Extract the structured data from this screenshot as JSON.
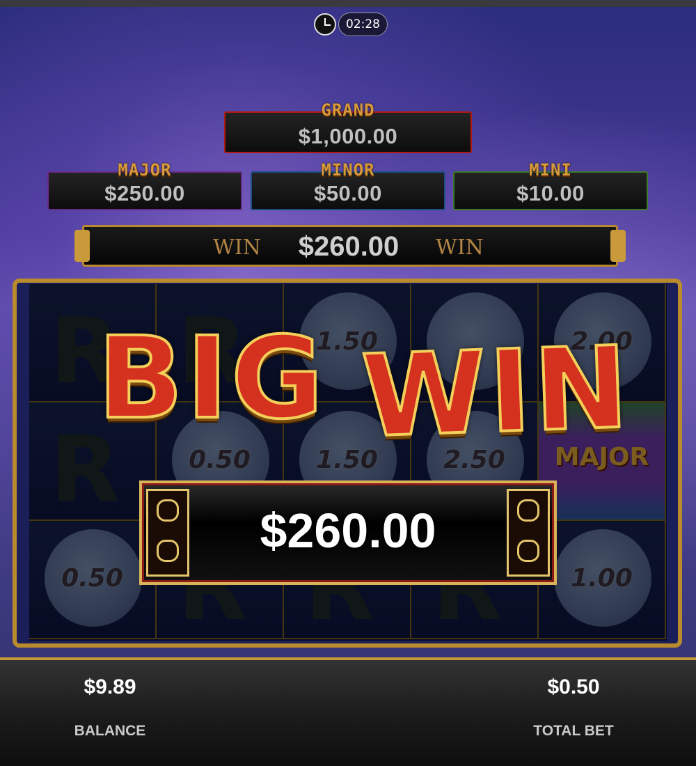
{
  "status": {
    "time": "02:28"
  },
  "jackpots": {
    "grand": {
      "label": "GRAND",
      "value": "$1,000.00",
      "border": "#b01a12"
    },
    "major": {
      "label": "MAJOR",
      "value": "$250.00",
      "border": "#6a2b8e"
    },
    "minor": {
      "label": "MINOR",
      "value": "$50.00",
      "border": "#1b4f86"
    },
    "mini": {
      "label": "MINI",
      "value": "$10.00",
      "border": "#3c7a2a"
    }
  },
  "win_bar": {
    "left_word": "WIN",
    "amount": "$260.00",
    "right_word": "WIN"
  },
  "reels": {
    "visible_values": [
      "1.50",
      "2.00",
      "0.50",
      "1.50",
      "2.50",
      "0.50",
      "1.00"
    ],
    "major_symbol": "MAJOR"
  },
  "big_win": {
    "word1": "BIG",
    "word2": "WIN",
    "amount": "$260.00"
  },
  "footer": {
    "balance_value": "$9.89",
    "balance_label": "BALANCE",
    "bet_value": "$0.50",
    "bet_label": "TOTAL BET"
  },
  "colors": {
    "accent_gold": "#c99a3a",
    "bigwin_red": "#d5311f"
  }
}
